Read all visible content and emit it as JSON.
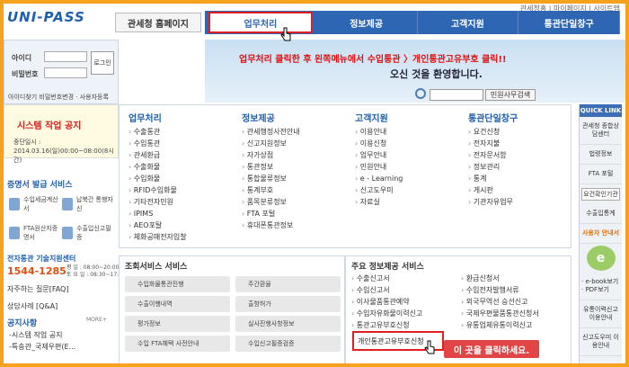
{
  "header": {
    "logo": "UNI-PASS",
    "home": "관세청 홈페이지",
    "util": "관세청홈 | 마이페이지 | 사이트맵"
  },
  "nav": [
    "업무처리",
    "정보제공",
    "고객지원",
    "통관단일창구"
  ],
  "instruction": "업무처리 클릭한 후 왼쪽메뉴에서  수입통관 〉개인통관고유부호 클릭!!",
  "banner": {
    "text": "오신 것을 환영합니다.",
    "search_button": "민원사무검색"
  },
  "login": {
    "id": "아이디",
    "pw": "비밀번호",
    "button": "로그인",
    "links": "아이디찾기 비밀번호변경 · 사용자등록"
  },
  "promo": {
    "title": "시스템 작업 공지",
    "sub": "중단일시 :",
    "date": "2014.03.16(일)00:00~08:00(8시간)"
  },
  "cert": {
    "title": "증명서 발급 서비스",
    "items": [
      "수입세금계산서",
      "납북간 통행자신",
      "FTA원산지증명서",
      "수출입신고필증"
    ]
  },
  "help": {
    "title": "전자통관 기술지원센터",
    "phone": "1544-1285",
    "time": "평 일 : 08:00~20:00\n토 요 일 : 08:30~17:30",
    "faq": "자주하는 질문[FAQ]",
    "consult": "상담사례 [Q&A]"
  },
  "notice": {
    "title": "공지사항",
    "more": "MORE+",
    "items": [
      "-시스템 작업 공지",
      "-특송관_국제우편(E..."
    ]
  },
  "menus": [
    {
      "title": "업무처리",
      "items": [
        "수출통관",
        "수입통관",
        "관세환급",
        "수출화물",
        "수입화물",
        "RFID수입화물",
        "기타전자민원",
        "IPIMS",
        "AEO포탈",
        "체화공매전자입찰"
      ]
    },
    {
      "title": "정보제공",
      "items": [
        "관세행정사전안내",
        "신고지원정보",
        "자가상점",
        "통관정보",
        "통합물류정보",
        "통계부호",
        "품목분류정보",
        "FTA 포털",
        "휴대폰통관정보"
      ]
    },
    {
      "title": "고객지원",
      "items": [
        "이용안내",
        "이용신청",
        "업무안내",
        "민원안내",
        "e - Learning",
        "신고도우미",
        "자료실"
      ]
    },
    {
      "title": "통관단일창구",
      "items": [
        "요건신청",
        "전자지불",
        "전자문서함",
        "정보관리",
        "통계",
        "게시판",
        "기관자유업무"
      ]
    }
  ],
  "services": {
    "title": "조회서비스 서비스",
    "items": [
      "수입화물통관진행",
      "주간환율",
      "수출이행내역",
      "출항허가",
      "평가정보",
      "실사진행사항정보",
      "수입 FTA혜택 사전안내",
      "수입신고필증검증"
    ]
  },
  "info": {
    "title": "주요 정보제공 서비스",
    "items": [
      "수출신고서",
      "환급신청서",
      "수입신고서",
      "수입전자발행서류",
      "이사물품통관예약",
      "외국무역선 승선신고",
      "수입자유화물이력신고",
      "국제우편물품통관신청서",
      "통관고유부호신청",
      "유통업체유통이력신고"
    ],
    "highlight": "개인통관고유부호신청"
  },
  "tip": "이 곳을 클릭하세요.",
  "quick": {
    "title": "QUICK LINK",
    "items": [
      "관세청 종합상담센터",
      "법령정보",
      "FTA 포털"
    ],
    "select": "요건확인기관",
    "link": "수출입통계",
    "guide": "사용자 안내서",
    "eb": "e",
    "ebooks": "· e-book보기\n· PDF보기",
    "bottom": [
      "유통이력신고 이용안내",
      "신고도우미 이용안내"
    ]
  }
}
